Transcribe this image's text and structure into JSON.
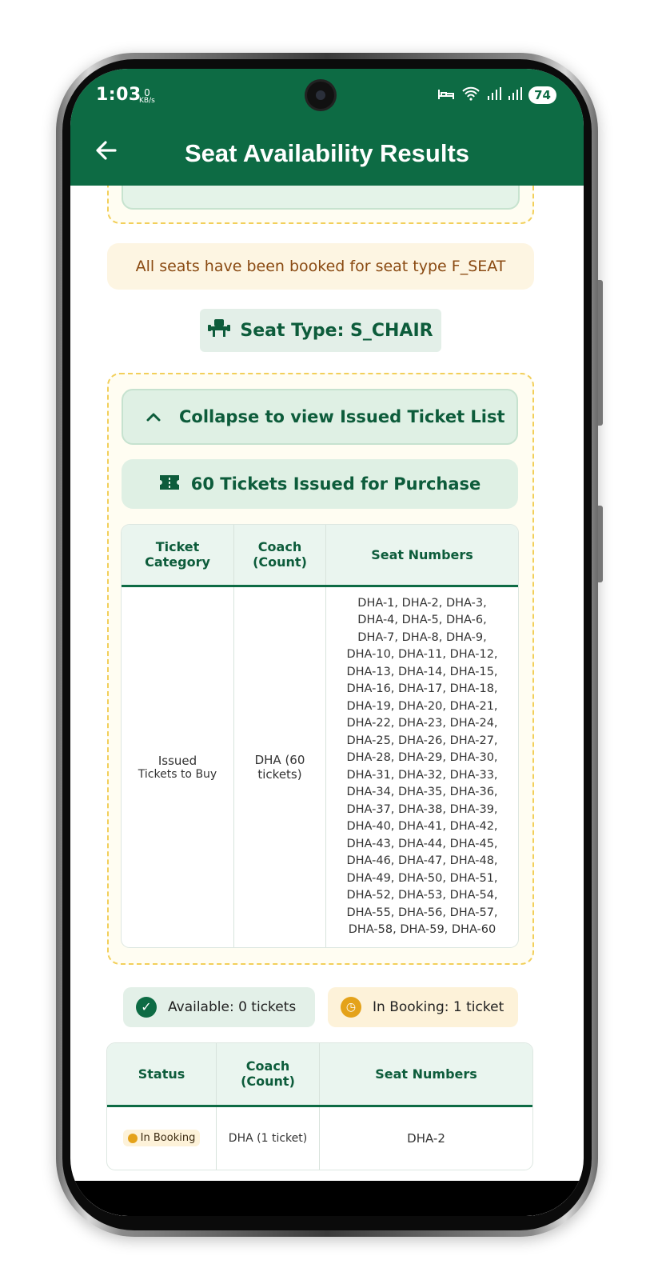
{
  "status_bar": {
    "time": "1:03",
    "net_speed_value": "0",
    "net_speed_unit": "KB/s",
    "battery": "74",
    "icons": [
      "alarm-bed-icon",
      "wifi-icon",
      "signal-icon",
      "signal-icon"
    ]
  },
  "app_bar": {
    "back_icon": "arrow-left-icon",
    "title": "Seat Availability Results"
  },
  "warning_text": "All seats have been booked for seat type F_SEAT",
  "seat_type": {
    "icon": "seat-icon",
    "label": "Seat Type: S_CHAIR"
  },
  "collapse_button": {
    "icon": "chevron-up-icon",
    "label": "Collapse to view Issued Ticket List"
  },
  "issued_summary": {
    "icon": "ticket-icon",
    "label": "60 Tickets Issued for Purchase"
  },
  "issued_table": {
    "headers": {
      "category_l1": "Ticket",
      "category_l2": "Category",
      "coach_l1": "Coach",
      "coach_l2": "(Count)",
      "seats": "Seat Numbers"
    },
    "row": {
      "category_l1": "Issued",
      "category_l2": "Tickets to Buy",
      "coach_l1": "DHA (60",
      "coach_l2": "tickets)",
      "seat_lines": [
        "DHA-1, DHA-2, DHA-3,",
        "DHA-4, DHA-5, DHA-6,",
        "DHA-7, DHA-8, DHA-9,",
        "DHA-10, DHA-11, DHA-12,",
        "DHA-13, DHA-14, DHA-15,",
        "DHA-16, DHA-17, DHA-18,",
        "DHA-19, DHA-20, DHA-21,",
        "DHA-22, DHA-23, DHA-24,",
        "DHA-25, DHA-26, DHA-27,",
        "DHA-28, DHA-29, DHA-30,",
        "DHA-31, DHA-32, DHA-33,",
        "DHA-34, DHA-35, DHA-36,",
        "DHA-37, DHA-38, DHA-39,",
        "DHA-40, DHA-41, DHA-42,",
        "DHA-43, DHA-44, DHA-45,",
        "DHA-46, DHA-47, DHA-48,",
        "DHA-49, DHA-50, DHA-51,",
        "DHA-52, DHA-53, DHA-54,",
        "DHA-55, DHA-56, DHA-57,",
        "DHA-58, DHA-59, DHA-60"
      ]
    }
  },
  "availability": {
    "available": "Available: 0 tickets",
    "in_booking": "In Booking: 1 ticket"
  },
  "booking_table": {
    "headers": {
      "status": "Status",
      "coach_l1": "Coach",
      "coach_l2": "(Count)",
      "seats": "Seat Numbers"
    },
    "row": {
      "status": "In Booking",
      "coach": "DHA (1 ticket)",
      "seats": "DHA-2"
    }
  },
  "colors": {
    "primary": "#0d6b44",
    "warning_bg": "#fdf5e2",
    "dashed_border": "#f2cf5a",
    "booking_amber": "#e4a21a"
  }
}
